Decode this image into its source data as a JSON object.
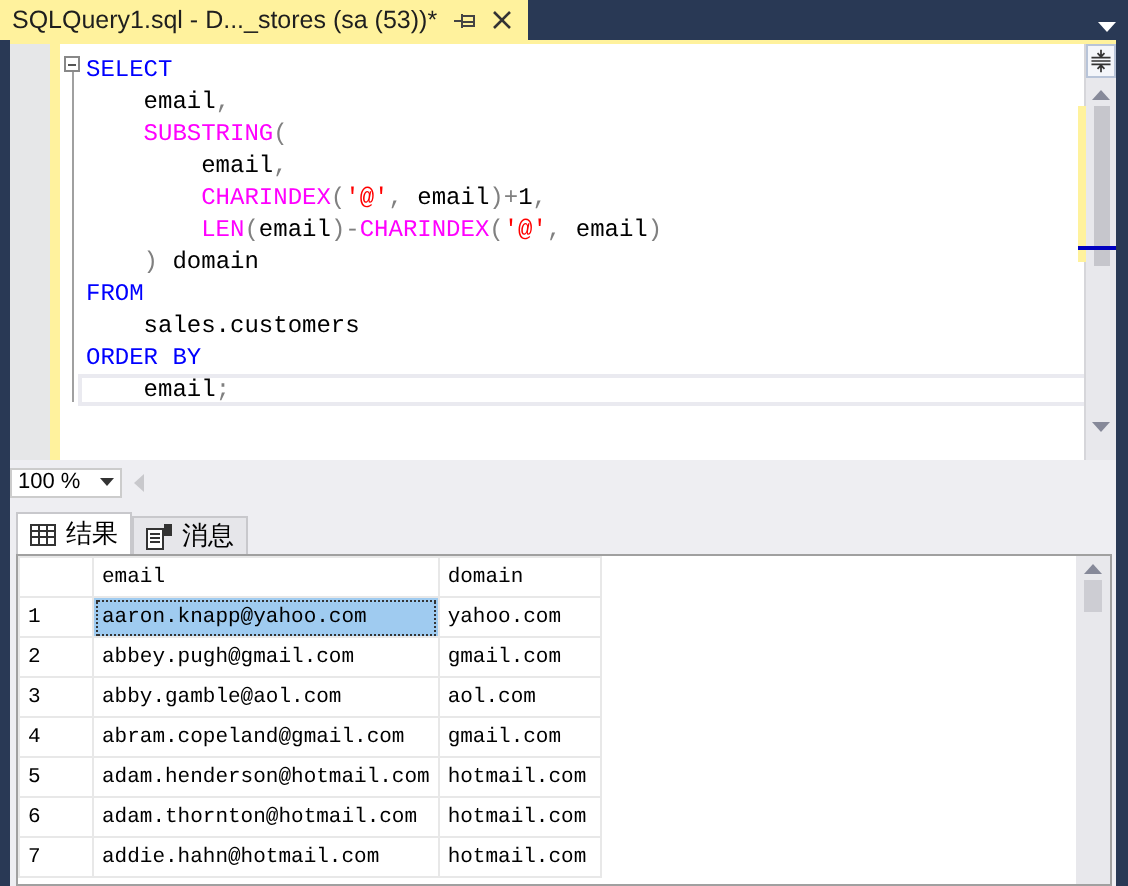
{
  "document_tab": {
    "title": "SQLQuery1.sql - D..._stores (sa (53))*",
    "selected": true
  },
  "editor": {
    "lines": [
      [
        {
          "kind": "keyword",
          "text": "SELECT"
        }
      ],
      [
        {
          "kind": "plain",
          "text": "    email"
        },
        {
          "kind": "operator",
          "text": ","
        }
      ],
      [
        {
          "kind": "function",
          "text": "    SUBSTRING"
        },
        {
          "kind": "operator",
          "text": "("
        }
      ],
      [
        {
          "kind": "plain",
          "text": "        email"
        },
        {
          "kind": "operator",
          "text": ","
        }
      ],
      [
        {
          "kind": "function",
          "text": "        CHARINDEX"
        },
        {
          "kind": "operator",
          "text": "("
        },
        {
          "kind": "string",
          "text": "'@'"
        },
        {
          "kind": "operator",
          "text": ","
        },
        {
          "kind": "plain",
          "text": " email"
        },
        {
          "kind": "operator",
          "text": ")+"
        },
        {
          "kind": "plain",
          "text": "1"
        },
        {
          "kind": "operator",
          "text": ","
        }
      ],
      [
        {
          "kind": "function",
          "text": "        LEN"
        },
        {
          "kind": "operator",
          "text": "("
        },
        {
          "kind": "plain",
          "text": "email"
        },
        {
          "kind": "operator",
          "text": ")-"
        },
        {
          "kind": "function",
          "text": "CHARINDEX"
        },
        {
          "kind": "operator",
          "text": "("
        },
        {
          "kind": "string",
          "text": "'@'"
        },
        {
          "kind": "operator",
          "text": ","
        },
        {
          "kind": "plain",
          "text": " email"
        },
        {
          "kind": "operator",
          "text": ")"
        }
      ],
      [
        {
          "kind": "operator",
          "text": "    )"
        },
        {
          "kind": "plain",
          "text": " domain"
        }
      ],
      [
        {
          "kind": "keyword",
          "text": "FROM"
        }
      ],
      [
        {
          "kind": "plain",
          "text": "    sales.customers"
        }
      ],
      [
        {
          "kind": "keyword",
          "text": "ORDER BY"
        }
      ],
      [
        {
          "kind": "plain",
          "text": "    email"
        },
        {
          "kind": "operator",
          "text": ";"
        }
      ]
    ],
    "current_line": {
      "selected": true
    }
  },
  "zoom": {
    "value": "100 %"
  },
  "result_tabs": [
    {
      "label": "结果",
      "kind": "grid",
      "selected": true
    },
    {
      "label": "消息",
      "kind": "messages",
      "selected": false
    }
  ],
  "grid": {
    "columns": [
      "email",
      "domain"
    ],
    "rows": [
      {
        "number": "1",
        "email": "aaron.knapp@yahoo.com",
        "domain": "yahoo.com",
        "selected": true
      },
      {
        "number": "2",
        "email": "abbey.pugh@gmail.com",
        "domain": "gmail.com",
        "selected": false
      },
      {
        "number": "3",
        "email": "abby.gamble@aol.com",
        "domain": "aol.com",
        "selected": false
      },
      {
        "number": "4",
        "email": "abram.copeland@gmail.com",
        "domain": "gmail.com",
        "selected": false
      },
      {
        "number": "5",
        "email": "adam.henderson@hotmail.com",
        "domain": "hotmail.com",
        "selected": false
      },
      {
        "number": "6",
        "email": "adam.thornton@hotmail.com",
        "domain": "hotmail.com",
        "selected": false
      },
      {
        "number": "7",
        "email": "addie.hahn@hotmail.com",
        "domain": "hotmail.com",
        "selected": false
      }
    ]
  }
}
